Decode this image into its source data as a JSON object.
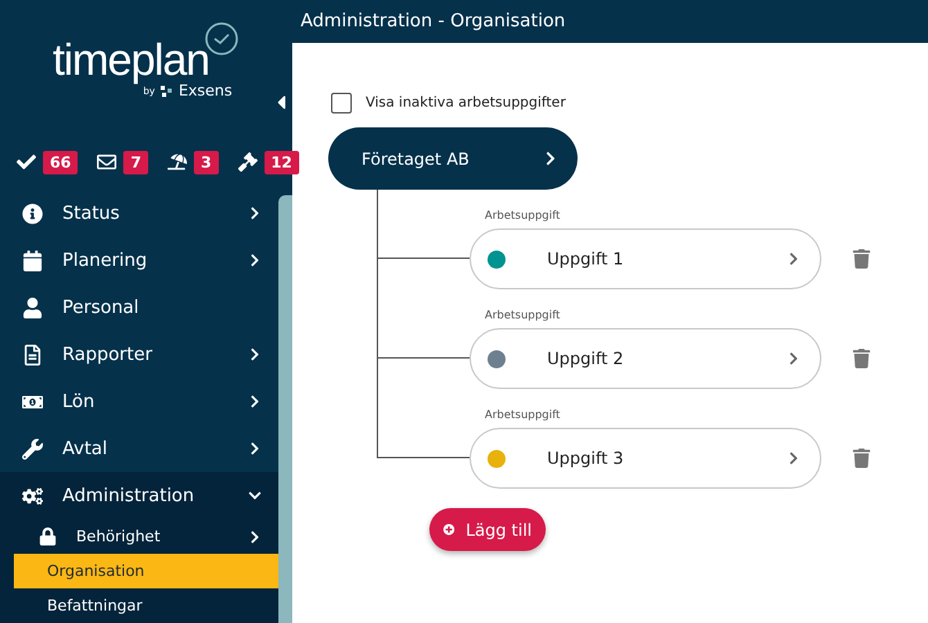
{
  "logo": {
    "wordmark": "timeplan",
    "byline": "by",
    "brand": "Exsens"
  },
  "badges": [
    {
      "kind": "check",
      "count": "66"
    },
    {
      "kind": "mail",
      "count": "7"
    },
    {
      "kind": "vacation",
      "count": "3"
    },
    {
      "kind": "hammer",
      "count": "12"
    }
  ],
  "sidebar": {
    "items": [
      {
        "kind": "info",
        "label": "Status",
        "expanded": false
      },
      {
        "kind": "calendar",
        "label": "Planering",
        "expanded": false
      },
      {
        "kind": "person",
        "label": "Personal"
      },
      {
        "kind": "document",
        "label": "Rapporter",
        "expanded": false
      },
      {
        "kind": "money",
        "label": "Lön",
        "expanded": false
      },
      {
        "kind": "wrench",
        "label": "Avtal",
        "expanded": false
      },
      {
        "kind": "gears",
        "label": "Administration",
        "expanded": true,
        "children": [
          {
            "kind": "lock",
            "label": "Behörighet",
            "expanded": false,
            "selected": false
          },
          {
            "kind": "plain",
            "label": "Organisation",
            "selected": true
          },
          {
            "kind": "plain",
            "label": "Befattningar",
            "selected": false
          }
        ]
      }
    ]
  },
  "header": {
    "title": "Administration - Organisation"
  },
  "show_inactive": {
    "label": "Visa inaktiva arbetsuppgifter",
    "checked": false
  },
  "organisation": {
    "name": "Företaget AB"
  },
  "tasks": [
    {
      "caption": "Arbetsuppgift",
      "name": "Uppgift 1",
      "color": "#00938f"
    },
    {
      "caption": "Arbetsuppgift",
      "name": "Uppgift 2",
      "color": "#6e8090"
    },
    {
      "caption": "Arbetsuppgift",
      "name": "Uppgift 3",
      "color": "#e8b10c"
    }
  ],
  "add_button": {
    "label": "Lägg till"
  }
}
